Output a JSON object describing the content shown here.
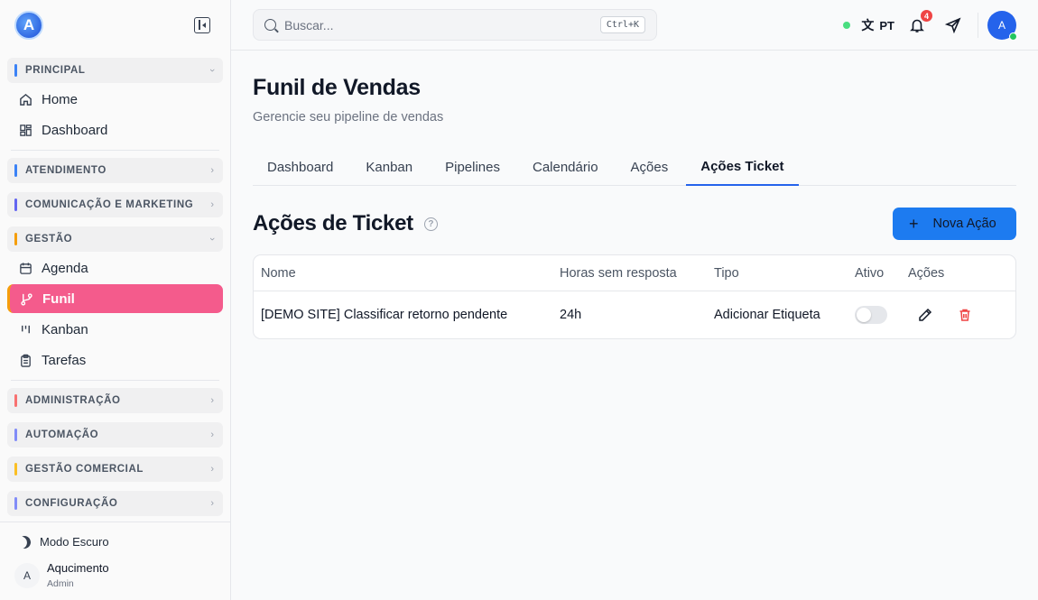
{
  "sidebar": {
    "sections": [
      {
        "label": "PRINCIPAL",
        "color": "#3b82f6",
        "expanded": true
      },
      {
        "label": "ATENDIMENTO",
        "color": "#3b82f6",
        "expanded": false
      },
      {
        "label": "COMUNICAÇÃO E MARKETING",
        "color": "#6366f1",
        "expanded": false
      },
      {
        "label": "GESTÃO",
        "color": "#f59e0b",
        "expanded": true
      },
      {
        "label": "ADMINISTRAÇÃO",
        "color": "#f87171",
        "expanded": false
      },
      {
        "label": "AUTOMAÇÃO",
        "color": "#818cf8",
        "expanded": false
      },
      {
        "label": "GESTÃO COMERCIAL",
        "color": "#fbbf24",
        "expanded": false
      },
      {
        "label": "CONFIGURAÇÃO",
        "color": "#818cf8",
        "expanded": false
      }
    ],
    "principal_items": [
      {
        "label": "Home",
        "icon": "home-icon"
      },
      {
        "label": "Dashboard",
        "icon": "dashboard-icon"
      }
    ],
    "gestao_items": [
      {
        "label": "Agenda",
        "icon": "calendar-icon"
      },
      {
        "label": "Funil",
        "icon": "branch-icon",
        "active": true
      },
      {
        "label": "Kanban",
        "icon": "kanban-icon"
      },
      {
        "label": "Tarefas",
        "icon": "clipboard-icon"
      }
    ],
    "dark_mode_label": "Modo Escuro",
    "user": {
      "initial": "A",
      "name": "Aqucimento",
      "role": "Admin"
    }
  },
  "topbar": {
    "search_placeholder": "Buscar...",
    "shortcut": "Ctrl+K",
    "lang": "PT",
    "notifications": "4",
    "avatar_initial": "A"
  },
  "page": {
    "title": "Funil de Vendas",
    "subtitle": "Gerencie seu pipeline de vendas",
    "tabs": [
      "Dashboard",
      "Kanban",
      "Pipelines",
      "Calendário",
      "Ações",
      "Ações Ticket"
    ],
    "active_tab": "Ações Ticket"
  },
  "section": {
    "title": "Ações de Ticket",
    "new_button": "Nova Ação"
  },
  "table": {
    "headers": [
      "Nome",
      "Horas sem resposta",
      "Tipo",
      "Ativo",
      "Ações"
    ],
    "rows": [
      {
        "nome": "[DEMO SITE] Classificar retorno pendente",
        "horas": "24h",
        "tipo": "Adicionar Etiqueta",
        "ativo": false
      }
    ]
  }
}
